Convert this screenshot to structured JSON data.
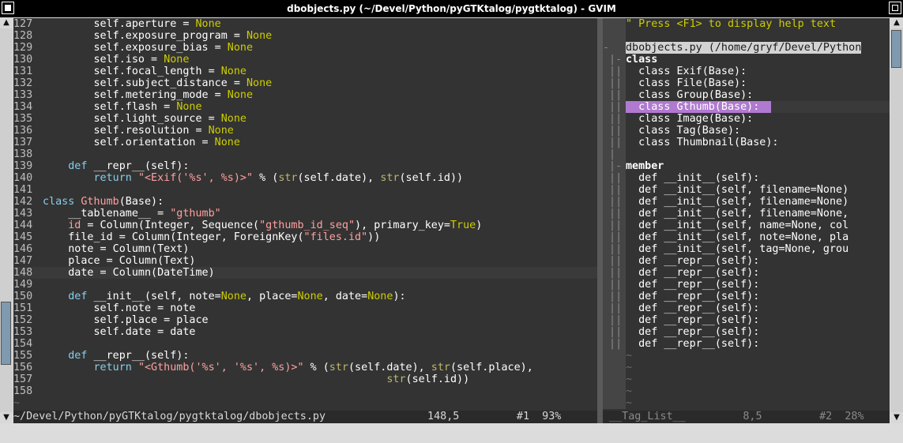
{
  "window": {
    "title": "dbobjects.py (~/Devel/Python/pyGTKtalog/pygtktalog) - GVIM"
  },
  "code_lines": [
    {
      "num": "127",
      "html": "        self.aperture = <span class='cn'>None</span>"
    },
    {
      "num": "128",
      "html": "        self.exposure_program = <span class='cn'>None</span>"
    },
    {
      "num": "129",
      "html": "        self.exposure_bias = <span class='cn'>None</span>"
    },
    {
      "num": "130",
      "html": "        self.iso = <span class='cn'>None</span>"
    },
    {
      "num": "131",
      "html": "        self.focal_length = <span class='cn'>None</span>"
    },
    {
      "num": "132",
      "html": "        self.subject_distance = <span class='cn'>None</span>"
    },
    {
      "num": "133",
      "html": "        self.metering_mode = <span class='cn'>None</span>"
    },
    {
      "num": "134",
      "html": "        self.flash = <span class='cn'>None</span>"
    },
    {
      "num": "135",
      "html": "        self.light_source = <span class='cn'>None</span>"
    },
    {
      "num": "136",
      "html": "        self.resolution = <span class='cn'>None</span>"
    },
    {
      "num": "137",
      "html": "        self.orientation = <span class='cn'>None</span>"
    },
    {
      "num": "138",
      "html": ""
    },
    {
      "num": "139",
      "html": "    <span class='kw'>def</span> __repr__(self):"
    },
    {
      "num": "140",
      "html": "        <span class='kw'>return</span> <span class='st'>\"&lt;Exif('%s', %s)&gt;\"</span> % (<span class='ty'>str</span>(self.date), <span class='ty'>str</span>(self.id))"
    },
    {
      "num": "141",
      "html": ""
    },
    {
      "num": "142",
      "html": "<span class='kw'>class</span> <span class='st'>Gthumb</span>(Base):"
    },
    {
      "num": "143",
      "html": "    __tablename__ = <span class='st'>\"gthumb\"</span>"
    },
    {
      "num": "144",
      "html": "    <span class='st'>id</span> = Column(Integer, Sequence(<span class='st'>\"gthumb_id_seq\"</span>), primary_key=<span class='cn'>True</span>)"
    },
    {
      "num": "145",
      "html": "    file_id = Column(Integer, ForeignKey(<span class='st'>\"files.id\"</span>))"
    },
    {
      "num": "146",
      "html": "    note = Column(Text)"
    },
    {
      "num": "147",
      "html": "    place = Column(Text)"
    },
    {
      "num": "148",
      "html": "    date = Column(DateTime)",
      "current": true
    },
    {
      "num": "149",
      "html": ""
    },
    {
      "num": "150",
      "html": "    <span class='kw'>def</span> __init__(self, note=<span class='cn'>None</span>, place=<span class='cn'>None</span>, date=<span class='cn'>None</span>):"
    },
    {
      "num": "151",
      "html": "        self.note = note"
    },
    {
      "num": "152",
      "html": "        self.place = place"
    },
    {
      "num": "153",
      "html": "        self.date = date"
    },
    {
      "num": "154",
      "html": ""
    },
    {
      "num": "155",
      "html": "    <span class='kw'>def</span> __repr__(self):"
    },
    {
      "num": "156",
      "html": "        <span class='kw'>return</span> <span class='st'>\"&lt;Gthumb('%s', '%s', %s)&gt;\"</span> % (<span class='ty'>str</span>(self.date), <span class='ty'>str</span>(self.place),"
    },
    {
      "num": "157",
      "html": "                                                      <span class='ty'>str</span>(self.id))"
    },
    {
      "num": "158",
      "html": ""
    }
  ],
  "taglist": {
    "hint": "\" Press <F1> to display help text",
    "file": "dbobjects.py (/home/gryf/Devel/Python",
    "rows": [
      {
        "fold": "  ",
        "text": "",
        "type": "blank"
      },
      {
        "fold": "- ",
        "text": "",
        "type": "file"
      },
      {
        "fold": " |-",
        "text": "class",
        "type": "head"
      },
      {
        "fold": " ||",
        "text": "  class Exif(Base):",
        "type": "txt"
      },
      {
        "fold": " ||",
        "text": "  class File(Base):",
        "type": "txt"
      },
      {
        "fold": " ||",
        "text": "  class Group(Base):",
        "type": "txt"
      },
      {
        "fold": " ||",
        "text": "  class Gthumb(Base):",
        "type": "sel"
      },
      {
        "fold": " ||",
        "text": "  class Image(Base):",
        "type": "txt"
      },
      {
        "fold": " ||",
        "text": "  class Tag(Base):",
        "type": "txt"
      },
      {
        "fold": " ||",
        "text": "  class Thumbnail(Base):",
        "type": "txt"
      },
      {
        "fold": " |",
        "text": "",
        "type": "blank"
      },
      {
        "fold": " |-",
        "text": "member",
        "type": "head"
      },
      {
        "fold": " ||",
        "text": "  def __init__(self):",
        "type": "txt"
      },
      {
        "fold": " ||",
        "text": "  def __init__(self, filename=None)",
        "type": "txt"
      },
      {
        "fold": " ||",
        "text": "  def __init__(self, filename=None)",
        "type": "txt"
      },
      {
        "fold": " ||",
        "text": "  def __init__(self, filename=None,",
        "type": "txt"
      },
      {
        "fold": " ||",
        "text": "  def __init__(self, name=None, col",
        "type": "txt"
      },
      {
        "fold": " ||",
        "text": "  def __init__(self, note=None, pla",
        "type": "txt"
      },
      {
        "fold": " ||",
        "text": "  def __init__(self, tag=None, grou",
        "type": "txt"
      },
      {
        "fold": " ||",
        "text": "  def __repr__(self):",
        "type": "txt"
      },
      {
        "fold": " ||",
        "text": "  def __repr__(self):",
        "type": "txt"
      },
      {
        "fold": " ||",
        "text": "  def __repr__(self):",
        "type": "txt"
      },
      {
        "fold": " ||",
        "text": "  def __repr__(self):",
        "type": "txt"
      },
      {
        "fold": " ||",
        "text": "  def __repr__(self):",
        "type": "txt"
      },
      {
        "fold": " ||",
        "text": "  def __repr__(self):",
        "type": "txt"
      },
      {
        "fold": " ||",
        "text": "  def __repr__(self):",
        "type": "txt"
      },
      {
        "fold": " ||",
        "text": "  def __repr__(self):",
        "type": "txt"
      }
    ]
  },
  "status_left": "~/Devel/Python/pyGTKtalog/pygtktalog/dbobjects.py                148,5         #1  93%",
  "status_right": " __Tag_List__         8,5         #2  28%"
}
